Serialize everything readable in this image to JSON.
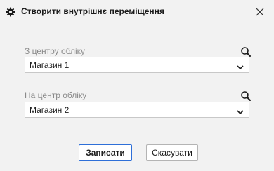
{
  "dialog": {
    "title": "Створити внутрішнє переміщення",
    "title_icon": "gear-icon",
    "close_icon": "close-icon"
  },
  "from_center": {
    "label": "З центру обліку",
    "value": "Магазин 1",
    "search_icon": "search-icon",
    "dropdown_icon": "chevron-down-icon"
  },
  "to_center": {
    "label": "На центр обліку",
    "value": "Магазин 2",
    "search_icon": "search-icon",
    "dropdown_icon": "chevron-down-icon"
  },
  "buttons": {
    "save_label": "Записати",
    "cancel_label": "Скасувати"
  },
  "colors": {
    "primary_border": "#2e6fd8",
    "background": "#f2f2f2"
  }
}
